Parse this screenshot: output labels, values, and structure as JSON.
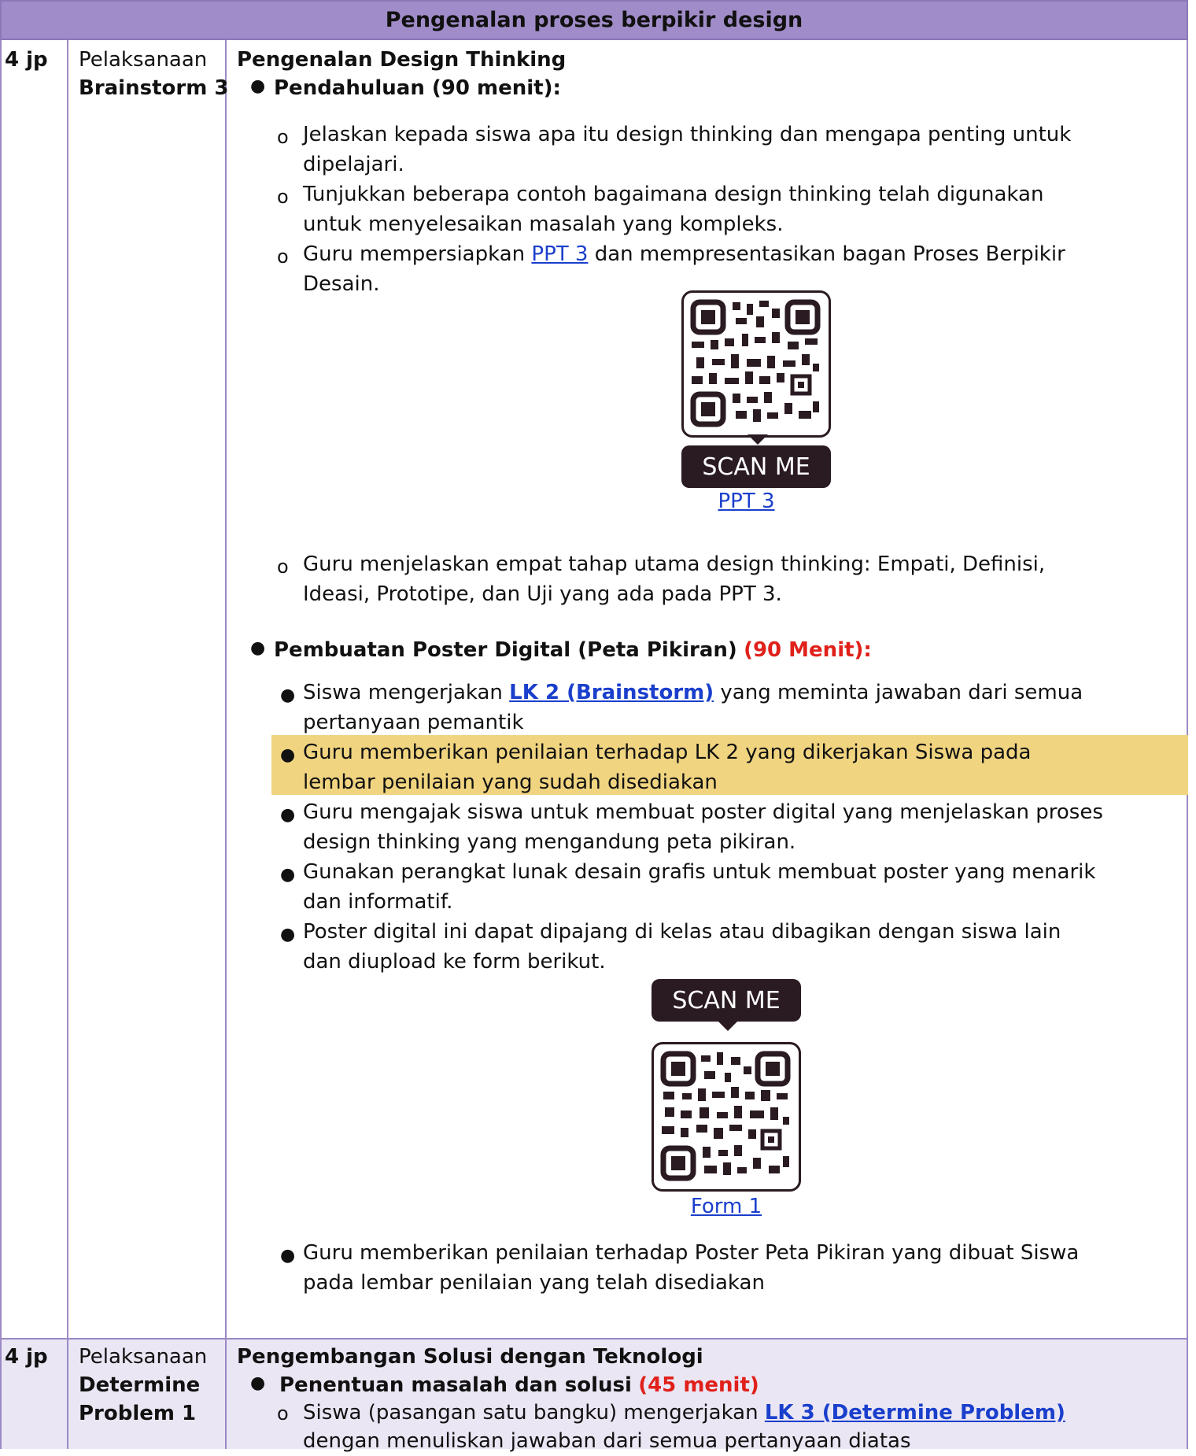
{
  "header": {
    "title": "Pengenalan proses berpikir design"
  },
  "rows": [
    {
      "jp": "4 jp",
      "stage": "Pelaksanaan",
      "activity": "Brainstorm 3",
      "heading": "Pengenalan Design Thinking",
      "sections": [
        {
          "title": "Pendahuluan (90 menit):",
          "items": [
            {
              "line1": "Jelaskan kepada siswa apa itu design thinking dan mengapa penting untuk",
              "line2": "dipelajari."
            },
            {
              "line1": "Tunjukkan beberapa contoh bagaimana design thinking telah digunakan",
              "line2": "untuk menyelesaikan masalah yang kompleks."
            },
            {
              "pre": "Guru mempersiapkan ",
              "link": "PPT 3",
              "post": " dan mempresentasikan bagan Proses Berpikir",
              "line2": "Desain."
            }
          ],
          "qr": {
            "label": "SCAN ME",
            "caption": "PPT 3"
          },
          "after": {
            "line1": "Guru menjelaskan empat tahap utama design thinking: Empati, Definisi,",
            "line2": "Ideasi, Prototipe, dan Uji yang ada pada PPT 3."
          }
        },
        {
          "title": "Pembuatan Poster Digital (Peta Pikiran)",
          "time": "(90 Menit):",
          "items": [
            {
              "pre": "Siswa mengerjakan ",
              "link": "LK 2 (Brainstorm)",
              "post": " yang meminta jawaban dari semua",
              "line2": "pertanyaan pemantik"
            },
            {
              "line1": "Guru memberikan penilaian terhadap LK 2 yang dikerjakan Siswa pada",
              "line2": "lembar penilaian yang sudah disediakan"
            },
            {
              "line1": "Guru mengajak siswa untuk membuat poster digital yang menjelaskan proses",
              "line2": "design thinking yang mengandung peta pikiran."
            },
            {
              "line1": "Gunakan perangkat lunak desain grafis untuk membuat poster yang menarik",
              "line2": "dan informatif."
            },
            {
              "line1": "Poster digital ini dapat dipajang di kelas atau dibagikan dengan siswa lain",
              "line2": "dan diupload ke form berikut."
            }
          ],
          "qr": {
            "label": "SCAN ME",
            "caption": "Form 1"
          },
          "after": {
            "line1": "Guru memberikan penilaian terhadap Poster Peta Pikiran yang dibuat Siswa",
            "line2": "pada lembar penilaian yang telah disediakan"
          }
        }
      ]
    },
    {
      "jp": "4 jp",
      "stage": "Pelaksanaan",
      "activity1": "Determine",
      "activity2": "Problem 1",
      "heading": "Pengembangan Solusi dengan Teknologi",
      "section": {
        "title": "Penentuan masalah dan solusi",
        "time": "(45 menit)",
        "item": {
          "pre": "Siswa (pasangan satu bangku) mengerjakan ",
          "link": "LK 3 (Determine Problem)",
          "line2": "dengan menuliskan jawaban dari semua pertanyaan diatas"
        }
      }
    }
  ],
  "colors": {
    "header_bg": "#a08cc8",
    "border": "#9b8ac4",
    "highlight": "#f0d480",
    "link": "#1a3fcc",
    "accent_red": "#e0201a",
    "row2_bg": "#ebe6f4"
  }
}
